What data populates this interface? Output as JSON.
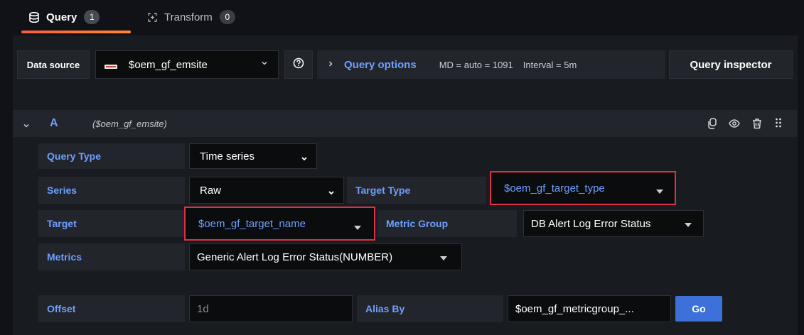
{
  "tabs": {
    "query": {
      "label": "Query",
      "count": "1"
    },
    "transform": {
      "label": "Transform",
      "count": "0"
    }
  },
  "toolbar": {
    "datasource_label": "Data source",
    "datasource_value": "$oem_gf_emsite",
    "query_options": "Query options",
    "md": "MD = auto = 1091",
    "interval": "Interval = 5m",
    "query_inspector": "Query inspector"
  },
  "query": {
    "ref": "A",
    "datasource": "($oem_gf_emsite)",
    "query_type_label": "Query Type",
    "query_type_value": "Time series",
    "series_label": "Series",
    "series_value": "Raw",
    "target_type_label": "Target Type",
    "target_type_value": "$oem_gf_target_type",
    "target_label": "Target",
    "target_value": "$oem_gf_target_name",
    "metric_group_label": "Metric Group",
    "metric_group_value": "DB Alert Log Error Status",
    "metrics_label": "Metrics",
    "metrics_value": "Generic Alert Log Error Status(NUMBER)",
    "offset_label": "Offset",
    "offset_placeholder": "1d",
    "alias_label": "Alias By",
    "alias_value": "$oem_gf_metricgroup_...",
    "go": "Go"
  },
  "colors": {
    "accent_blue": "#6e9fff",
    "highlight_red": "#e02f44",
    "tab_underline": "#f55f3e"
  }
}
